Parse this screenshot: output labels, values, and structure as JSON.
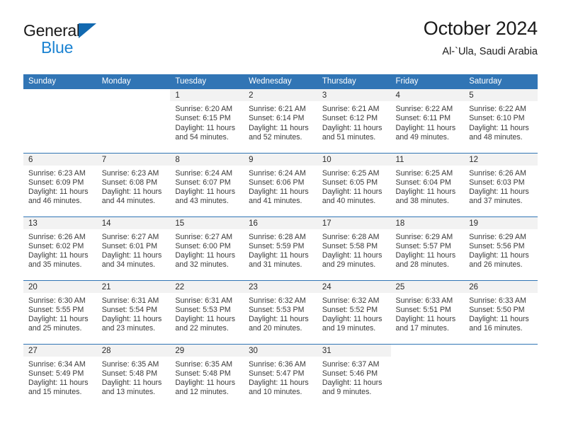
{
  "brand": {
    "word_1": "General",
    "word_2": "Blue",
    "triangle_color": "#1269b0",
    "blue_color": "#1b83d2"
  },
  "header": {
    "title": "October 2024",
    "subtitle": "Al-`Ula, Saudi Arabia"
  },
  "theme": {
    "header_blue": "#3175b5",
    "daynum_band": "#f2f2f2",
    "text": "#3a3a3a"
  },
  "weekdays": [
    "Sunday",
    "Monday",
    "Tuesday",
    "Wednesday",
    "Thursday",
    "Friday",
    "Saturday"
  ],
  "weeks": [
    [
      {
        "day": "",
        "blank": true,
        "lines": []
      },
      {
        "day": "",
        "blank": true,
        "lines": []
      },
      {
        "day": "1",
        "lines": [
          "Sunrise: 6:20 AM",
          "Sunset: 6:15 PM",
          "Daylight: 11 hours",
          "and 54 minutes."
        ]
      },
      {
        "day": "2",
        "lines": [
          "Sunrise: 6:21 AM",
          "Sunset: 6:14 PM",
          "Daylight: 11 hours",
          "and 52 minutes."
        ]
      },
      {
        "day": "3",
        "lines": [
          "Sunrise: 6:21 AM",
          "Sunset: 6:12 PM",
          "Daylight: 11 hours",
          "and 51 minutes."
        ]
      },
      {
        "day": "4",
        "lines": [
          "Sunrise: 6:22 AM",
          "Sunset: 6:11 PM",
          "Daylight: 11 hours",
          "and 49 minutes."
        ]
      },
      {
        "day": "5",
        "lines": [
          "Sunrise: 6:22 AM",
          "Sunset: 6:10 PM",
          "Daylight: 11 hours",
          "and 48 minutes."
        ]
      }
    ],
    [
      {
        "day": "6",
        "lines": [
          "Sunrise: 6:23 AM",
          "Sunset: 6:09 PM",
          "Daylight: 11 hours",
          "and 46 minutes."
        ]
      },
      {
        "day": "7",
        "lines": [
          "Sunrise: 6:23 AM",
          "Sunset: 6:08 PM",
          "Daylight: 11 hours",
          "and 44 minutes."
        ]
      },
      {
        "day": "8",
        "lines": [
          "Sunrise: 6:24 AM",
          "Sunset: 6:07 PM",
          "Daylight: 11 hours",
          "and 43 minutes."
        ]
      },
      {
        "day": "9",
        "lines": [
          "Sunrise: 6:24 AM",
          "Sunset: 6:06 PM",
          "Daylight: 11 hours",
          "and 41 minutes."
        ]
      },
      {
        "day": "10",
        "lines": [
          "Sunrise: 6:25 AM",
          "Sunset: 6:05 PM",
          "Daylight: 11 hours",
          "and 40 minutes."
        ]
      },
      {
        "day": "11",
        "lines": [
          "Sunrise: 6:25 AM",
          "Sunset: 6:04 PM",
          "Daylight: 11 hours",
          "and 38 minutes."
        ]
      },
      {
        "day": "12",
        "lines": [
          "Sunrise: 6:26 AM",
          "Sunset: 6:03 PM",
          "Daylight: 11 hours",
          "and 37 minutes."
        ]
      }
    ],
    [
      {
        "day": "13",
        "lines": [
          "Sunrise: 6:26 AM",
          "Sunset: 6:02 PM",
          "Daylight: 11 hours",
          "and 35 minutes."
        ]
      },
      {
        "day": "14",
        "lines": [
          "Sunrise: 6:27 AM",
          "Sunset: 6:01 PM",
          "Daylight: 11 hours",
          "and 34 minutes."
        ]
      },
      {
        "day": "15",
        "lines": [
          "Sunrise: 6:27 AM",
          "Sunset: 6:00 PM",
          "Daylight: 11 hours",
          "and 32 minutes."
        ]
      },
      {
        "day": "16",
        "lines": [
          "Sunrise: 6:28 AM",
          "Sunset: 5:59 PM",
          "Daylight: 11 hours",
          "and 31 minutes."
        ]
      },
      {
        "day": "17",
        "lines": [
          "Sunrise: 6:28 AM",
          "Sunset: 5:58 PM",
          "Daylight: 11 hours",
          "and 29 minutes."
        ]
      },
      {
        "day": "18",
        "lines": [
          "Sunrise: 6:29 AM",
          "Sunset: 5:57 PM",
          "Daylight: 11 hours",
          "and 28 minutes."
        ]
      },
      {
        "day": "19",
        "lines": [
          "Sunrise: 6:29 AM",
          "Sunset: 5:56 PM",
          "Daylight: 11 hours",
          "and 26 minutes."
        ]
      }
    ],
    [
      {
        "day": "20",
        "lines": [
          "Sunrise: 6:30 AM",
          "Sunset: 5:55 PM",
          "Daylight: 11 hours",
          "and 25 minutes."
        ]
      },
      {
        "day": "21",
        "lines": [
          "Sunrise: 6:31 AM",
          "Sunset: 5:54 PM",
          "Daylight: 11 hours",
          "and 23 minutes."
        ]
      },
      {
        "day": "22",
        "lines": [
          "Sunrise: 6:31 AM",
          "Sunset: 5:53 PM",
          "Daylight: 11 hours",
          "and 22 minutes."
        ]
      },
      {
        "day": "23",
        "lines": [
          "Sunrise: 6:32 AM",
          "Sunset: 5:53 PM",
          "Daylight: 11 hours",
          "and 20 minutes."
        ]
      },
      {
        "day": "24",
        "lines": [
          "Sunrise: 6:32 AM",
          "Sunset: 5:52 PM",
          "Daylight: 11 hours",
          "and 19 minutes."
        ]
      },
      {
        "day": "25",
        "lines": [
          "Sunrise: 6:33 AM",
          "Sunset: 5:51 PM",
          "Daylight: 11 hours",
          "and 17 minutes."
        ]
      },
      {
        "day": "26",
        "lines": [
          "Sunrise: 6:33 AM",
          "Sunset: 5:50 PM",
          "Daylight: 11 hours",
          "and 16 minutes."
        ]
      }
    ],
    [
      {
        "day": "27",
        "lines": [
          "Sunrise: 6:34 AM",
          "Sunset: 5:49 PM",
          "Daylight: 11 hours",
          "and 15 minutes."
        ]
      },
      {
        "day": "28",
        "lines": [
          "Sunrise: 6:35 AM",
          "Sunset: 5:48 PM",
          "Daylight: 11 hours",
          "and 13 minutes."
        ]
      },
      {
        "day": "29",
        "lines": [
          "Sunrise: 6:35 AM",
          "Sunset: 5:48 PM",
          "Daylight: 11 hours",
          "and 12 minutes."
        ]
      },
      {
        "day": "30",
        "lines": [
          "Sunrise: 6:36 AM",
          "Sunset: 5:47 PM",
          "Daylight: 11 hours",
          "and 10 minutes."
        ]
      },
      {
        "day": "31",
        "lines": [
          "Sunrise: 6:37 AM",
          "Sunset: 5:46 PM",
          "Daylight: 11 hours",
          "and 9 minutes."
        ]
      },
      {
        "day": "",
        "blank": true,
        "lines": []
      },
      {
        "day": "",
        "blank": true,
        "lines": []
      }
    ]
  ]
}
